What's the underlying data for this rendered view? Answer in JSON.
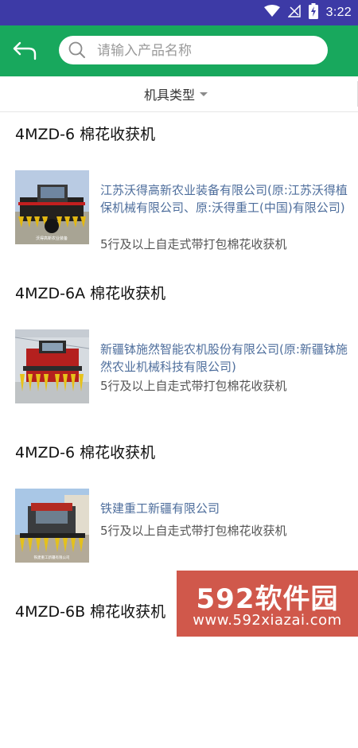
{
  "status_bar": {
    "time": "3:22",
    "icons": [
      "wifi-icon",
      "signal-icon",
      "battery-charging-icon"
    ],
    "background": "#3d3aa6"
  },
  "header": {
    "background": "#18a85d",
    "back_icon": "back-arrow-icon",
    "search": {
      "placeholder": "请输入产品名称",
      "value": ""
    }
  },
  "filter": {
    "label": "机具类型"
  },
  "products": [
    {
      "title": "4MZD-6 棉花收获机",
      "company": "江苏沃得高新农业装备有限公司(原:江苏沃得植保机械有限公司、原:沃得重工(中国)有限公司)",
      "type": "5行及以上自走式带打包棉花收获机",
      "thumb_caption": "沃得高新农业装备"
    },
    {
      "title": "4MZD-6A 棉花收获机",
      "company": "新疆钵施然智能农机股份有限公司(原:新疆钵施然农业机械科技有限公司)",
      "type": "5行及以上自走式带打包棉花收获机",
      "thumb_caption": ""
    },
    {
      "title": "4MZD-6 棉花收获机",
      "company": "铁建重工新疆有限公司",
      "type": "5行及以上自走式带打包棉花收获机",
      "thumb_caption": "铁建重工新疆有限公司"
    },
    {
      "title": "4MZD-6B 棉花收获机",
      "company": "",
      "type": "",
      "thumb_caption": ""
    }
  ],
  "watermark": {
    "logo": "592软件园",
    "url": "www.592xiazai.com",
    "color": "#c83c2d"
  }
}
